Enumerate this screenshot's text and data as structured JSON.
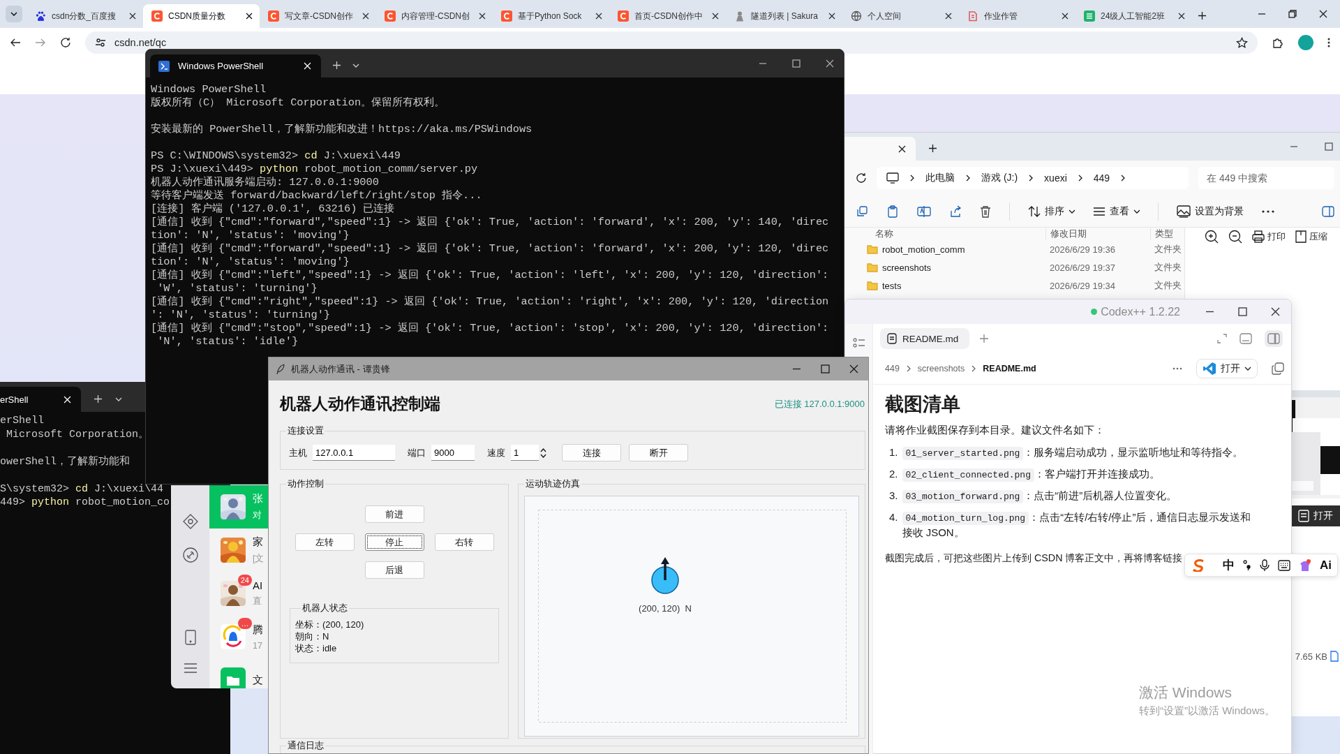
{
  "browser": {
    "tabs": [
      {
        "title": "csdn分数_百度搜",
        "selected": false
      },
      {
        "title": "CSDN质量分数",
        "selected": true
      },
      {
        "title": "写文章-CSDN创作",
        "selected": false
      },
      {
        "title": "内容管理-CSDN创",
        "selected": false
      },
      {
        "title": "基于Python Sock",
        "selected": false
      },
      {
        "title": "首页-CSDN创作中",
        "selected": false
      },
      {
        "title": "隧道列表 | Sakura",
        "selected": false
      },
      {
        "title": "个人空间",
        "selected": false
      },
      {
        "title": "作业作管",
        "selected": false
      },
      {
        "title": "24级人工智能2班",
        "selected": false
      }
    ],
    "address": "csdn.net/qc"
  },
  "back_terminal": {
    "tab": "erShell",
    "lines": [
      {
        "kind": "text",
        "text": "erShell"
      },
      {
        "kind": "text",
        "text": " Microsoft Corporation。"
      },
      {
        "kind": "blank"
      },
      {
        "kind": "text",
        "text": "owerShell，了解新功能和"
      },
      {
        "kind": "blank"
      },
      {
        "kind": "command",
        "prompt": "S\\system32> ",
        "command": "cd",
        "args": " J:\\xuexi\\44"
      },
      {
        "kind": "command",
        "prompt": "449> ",
        "command": "python",
        "args": " robot_motion_co"
      }
    ]
  },
  "chat": {
    "items": [
      {
        "kind": "picture",
        "name": "张",
        "preview": "对",
        "selected": true
      },
      {
        "kind": "picture",
        "name": "家",
        "preview": "[文",
        "selected": false
      },
      {
        "kind": "picture",
        "name": "AI",
        "preview": "直",
        "badge": "24",
        "selected": false
      },
      {
        "kind": "bell",
        "name": "腾",
        "preview": "17",
        "badge": "…",
        "selected": false
      },
      {
        "kind": "folder",
        "name": "文",
        "selected": false
      }
    ]
  },
  "terminal": {
    "tab": "Windows PowerShell",
    "lines": [
      {
        "kind": "text",
        "text": "Windows PowerShell"
      },
      {
        "kind": "text",
        "text": "版权所有（C） Microsoft Corporation。保留所有权利。"
      },
      {
        "kind": "blank"
      },
      {
        "kind": "text",
        "text": "安装最新的 PowerShell，了解新功能和改进！https://aka.ms/PSWindows"
      },
      {
        "kind": "blank"
      },
      {
        "kind": "command",
        "prompt": "PS C:\\WINDOWS\\system32> ",
        "command": "cd",
        "args": " J:\\xuexi\\449"
      },
      {
        "kind": "command",
        "prompt": "PS J:\\xuexi\\449> ",
        "command": "python",
        "args": " robot_motion_comm/server.py"
      },
      {
        "kind": "text",
        "text": "机器人动作通讯服务端启动: 127.0.0.1:9000"
      },
      {
        "kind": "text",
        "text": "等待客户端发送 forward/backward/left/right/stop 指令..."
      },
      {
        "kind": "text",
        "text": "[连接] 客户端 ('127.0.0.1', 63216) 已连接"
      },
      {
        "kind": "text",
        "text": "[通信] 收到 {\"cmd\":\"forward\",\"speed\":1} -> 返回 {'ok': True, 'action': 'forward', 'x': 200, 'y': 140, 'direc"
      },
      {
        "kind": "text",
        "text": "tion': 'N', 'status': 'moving'}"
      },
      {
        "kind": "text",
        "text": "[通信] 收到 {\"cmd\":\"forward\",\"speed\":1} -> 返回 {'ok': True, 'action': 'forward', 'x': 200, 'y': 120, 'direc"
      },
      {
        "kind": "text",
        "text": "tion': 'N', 'status': 'moving'}"
      },
      {
        "kind": "text",
        "text": "[通信] 收到 {\"cmd\":\"left\",\"speed\":1} -> 返回 {'ok': True, 'action': 'left', 'x': 200, 'y': 120, 'direction':"
      },
      {
        "kind": "text",
        "text": " 'W', 'status': 'turning'}"
      },
      {
        "kind": "text",
        "text": "[通信] 收到 {\"cmd\":\"right\",\"speed\":1} -> 返回 {'ok': True, 'action': 'right', 'x': 200, 'y': 120, 'direction"
      },
      {
        "kind": "text",
        "text": "': 'N', 'status': 'turning'}"
      },
      {
        "kind": "text",
        "text": "[通信] 收到 {\"cmd\":\"stop\",\"speed\":1} -> 返回 {'ok': True, 'action': 'stop', 'x': 200, 'y': 120, 'direction':"
      },
      {
        "kind": "text",
        "text": " 'N', 'status': 'idle'}"
      }
    ]
  },
  "explorer": {
    "breadcrumb": [
      "此电脑",
      "游戏 (J:)",
      "xuexi",
      "449"
    ],
    "search_placeholder": "在 449 中搜索",
    "sort": "排序",
    "view": "查看",
    "background": "设置为背景",
    "columns": [
      "名称",
      "修改日期",
      "类型"
    ],
    "rows": [
      {
        "name": "robot_motion_comm",
        "date": "2026/6/29 19:36",
        "type": "文件夹"
      },
      {
        "name": "screenshots",
        "date": "2026/6/29 19:37",
        "type": "文件夹"
      },
      {
        "name": "tests",
        "date": "2026/6/29 19:34",
        "type": "文件夹"
      }
    ],
    "preview_tools": [
      "打印",
      "压缩"
    ],
    "open": "打开",
    "size": "7.65 KB"
  },
  "codex": {
    "title": "Codex++ 1.2.22",
    "tab": "README.md",
    "path": [
      "449",
      "screenshots",
      "README.md"
    ],
    "open": "打开",
    "doc": {
      "title": "截图清单",
      "intro": "请将作业截图保存到本目录。建议文件名如下：",
      "items": [
        {
          "marker": "1.",
          "code": "01_server_started.png",
          "text": "：服务端启动成功，显示监听地址和等待指令。"
        },
        {
          "marker": "2.",
          "code": "02_client_connected.png",
          "text": "：客户端打开并连接成功。"
        },
        {
          "marker": "3.",
          "code": "03_motion_forward.png",
          "text": "：点击“前进”后机器人位置变化。"
        },
        {
          "marker": "4.",
          "code": "04_motion_turn_log.png",
          "text": "：点击“左转/右转/停止”后，通信日志显示发送和接收 JSON。"
        }
      ],
      "outro": "截图完成后，可把这些图片上传到 CSDN 博客正文中，再将博客链接"
    }
  },
  "robot_app": {
    "title": "机器人动作通讯 - 谭贵锋",
    "heading": "机器人动作通讯控制端",
    "status": "已连接 127.0.0.1:9000",
    "connected": true,
    "connection": {
      "legend": "连接设置",
      "fields": [
        {
          "label": "主机",
          "value": "127.0.0.1",
          "kind": "text"
        },
        {
          "label": "端口",
          "value": "9000",
          "kind": "text"
        },
        {
          "label": "速度",
          "value": "1",
          "kind": "spin"
        }
      ],
      "buttons": [
        "连接",
        "断开"
      ]
    },
    "control": {
      "legend": "动作控制",
      "buttons": [
        {
          "label": "前进",
          "focused": false
        },
        {
          "label": "左转",
          "focused": false
        },
        {
          "label": "停止",
          "focused": true
        },
        {
          "label": "右转",
          "focused": false
        },
        {
          "label": "后退",
          "focused": false
        }
      ]
    },
    "state": {
      "legend": "机器人状态",
      "lines": [
        "坐标：(200, 120)",
        "朝向：N",
        "状态：idle"
      ]
    },
    "sim": {
      "legend": "运动轨迹仿真",
      "label": "(200, 120)  N"
    },
    "log": {
      "legend": "通信日志"
    }
  },
  "ime": {
    "mode": "中",
    "ai": "Ai"
  },
  "activation": {
    "title": "激活 Windows",
    "hint": "转到“设置”以激活 Windows。"
  }
}
